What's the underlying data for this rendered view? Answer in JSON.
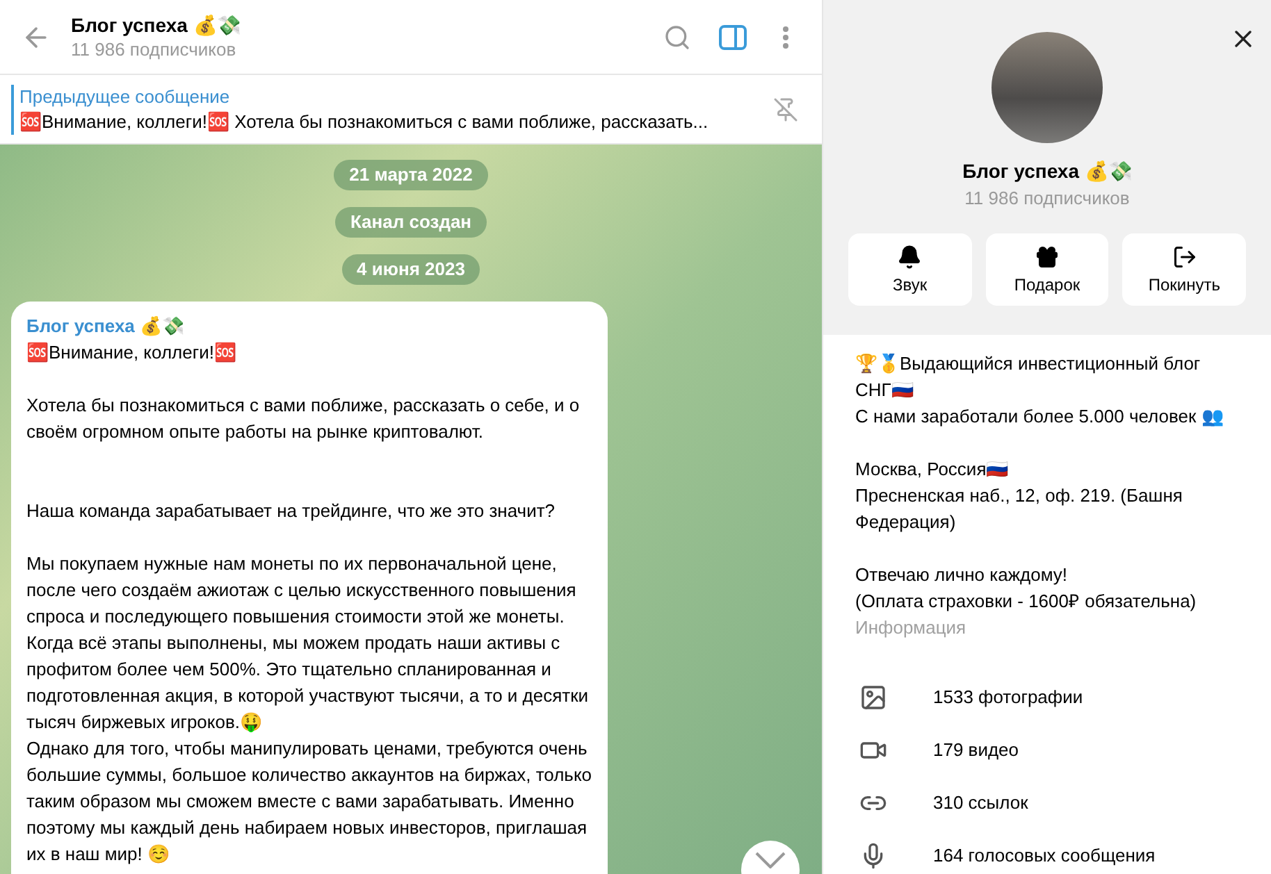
{
  "header": {
    "title": "Блог успеха 💰💸",
    "subtitle": "11 986 подписчиков",
    "sidebar_toggle": {
      "on": true
    }
  },
  "pinned": {
    "label": "Предыдущее сообщение",
    "text": "🆘Внимание, коллеги!🆘  Хотела бы познакомиться с вами поближе, рассказать..."
  },
  "service_messages": [
    "21 марта 2022",
    "Канал создан",
    "4 июня 2023"
  ],
  "message": {
    "author": "Блог успеха 💰💸",
    "paragraphs": [
      "🆘Внимание, коллеги!🆘",
      "Хотела бы познакомиться с вами поближе, рассказать о себе, и о своём огромном опыте работы на рынке криптовалют.",
      "Наша команда зарабатывает на трейдинге, что же это значит?",
      "Мы покупаем нужные нам монеты по их первоначальной цене, после чего создаём ажиотаж с целью искусственного повышения спроса и последующего повышения стоимости этой же монеты. Когда всё этапы выполнены, мы можем продать наши активы с профитом более чем 500%. Это тщательно спланированная и подготовленная акция, в которой участвуют тысячи, а то и десятки тысяч биржевых игроков.🤑\nОднако для того, чтобы манипулировать ценами, требуются очень большие суммы, большое количество аккаунтов на биржах, только таким образом мы сможем вместе с вами зарабатывать. Именно поэтому мы каждый день набираем новых инвесторов, приглашая их в наш мир! ☺️"
    ]
  },
  "profile": {
    "name": "Блог успеха 💰💸",
    "subtitle": "11 986 подписчиков",
    "actions": [
      {
        "kind": "bell",
        "label": "Звук"
      },
      {
        "kind": "gift",
        "label": "Подарок"
      },
      {
        "kind": "leave",
        "label": "Покинуть"
      }
    ],
    "about": [
      "🏆🥇Выдающийся инвестиционный блог СНГ🇷🇺\nС нами заработали более 5.000 человек 👥",
      "Москва, Россия🇷🇺\nПресненская наб., 12, оф. 219. (Башня Федерация)",
      "Отвечаю лично каждому!\n(Оплата страховки - 1600₽ обязательна)"
    ],
    "about_label": "Информация",
    "media": [
      {
        "kind": "photo",
        "label": "1533 фотографии"
      },
      {
        "kind": "video",
        "label": "179 видео"
      },
      {
        "kind": "link",
        "label": "310 ссылок"
      },
      {
        "kind": "voice",
        "label": "164 голосовых сообщения"
      }
    ]
  }
}
